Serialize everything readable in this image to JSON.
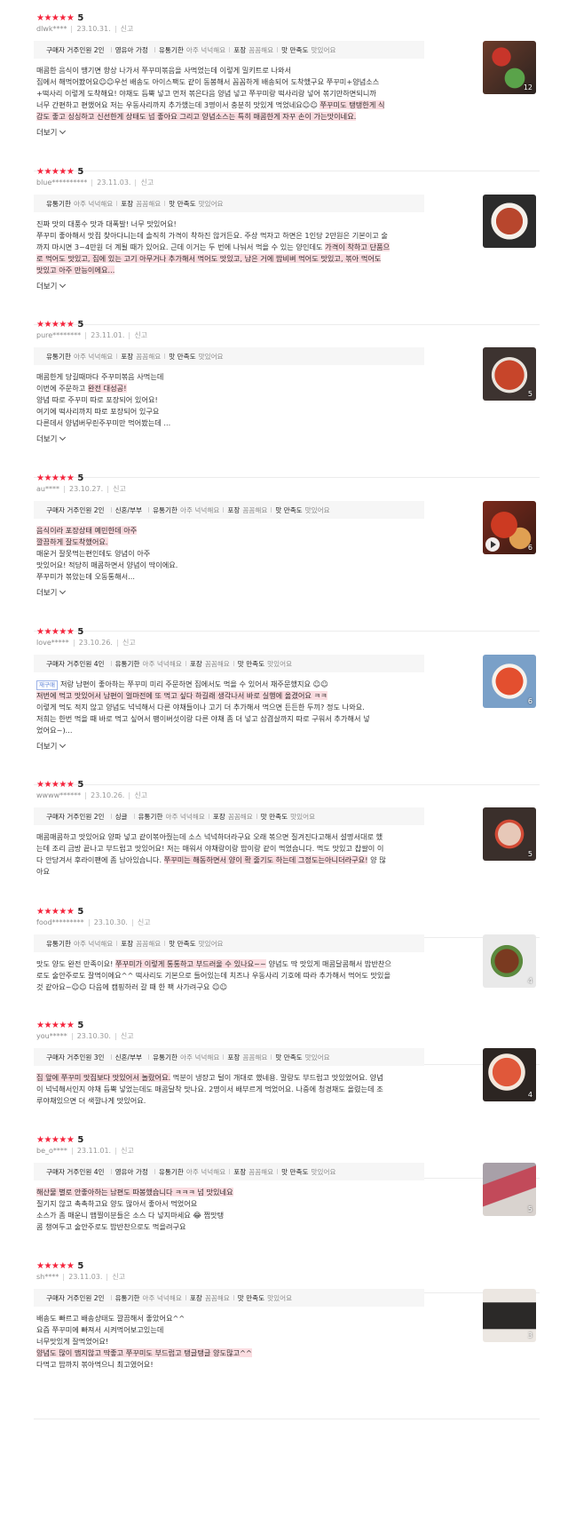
{
  "report_label": "신고",
  "more_label": "더보기",
  "rating_stars": "★★★★★",
  "reviews": [
    {
      "score": "5",
      "user": "dlwk****",
      "date": "23.10.31.",
      "options": [
        {
          "k": "구매자 거주인원 2인",
          "v": ""
        },
        {
          "k": "영유아 가정",
          "v": ""
        },
        {
          "k": "유통기한",
          "v": "아주 넉넉해요"
        },
        {
          "k": "포장",
          "v": "꼼꼼해요"
        },
        {
          "k": "맛 만족도",
          "v": "맛있어요"
        }
      ],
      "lines": [
        [
          {
            "t": "매콤한 음식이 땡기면 항상 나가서 쭈꾸미볶음을 사먹었는데 이렇게 밀키트로 나와서"
          }
        ],
        [
          {
            "t": "집에서 해먹어봤어요☺☺우선 배송도 아이스팩도 같이 동봉해서 꼼꼼하게 배송되어 도착했구요 쭈꾸미+양념소스"
          }
        ],
        [
          {
            "t": "+떡사리 이렇게 도착해요! 야채도 듬뿍 넣고 먼저 볶은다음 양념 넣고 쭈꾸미랑 떡사리랑 넣어 볶기만하면되니까"
          }
        ],
        [
          {
            "t": "너무 간편하고 편했어요 저는 우동사리까지 추가했는데 3명이서 충분히 맛있게 먹었네요☺☺ "
          },
          {
            "t": "쭈꾸미도 탱탱한게 식",
            "h": true
          }
        ],
        [
          {
            "t": "감도 좋고 싱싱하고 신선한게 상태도 넘 좋아요 그리고 양념소스는 특히 매콤한게 자꾸 손이 가는맛이네요.",
            "h": true
          }
        ]
      ],
      "photo_count": "12",
      "video": false
    },
    {
      "score": "5",
      "user": "blue**********",
      "date": "23.11.03.",
      "options": [
        {
          "k": "유통기한",
          "v": "아주 넉넉해요"
        },
        {
          "k": "포장",
          "v": "꼼꼼해요"
        },
        {
          "k": "맛 만족도",
          "v": "맛있어요"
        }
      ],
      "lines": [
        [
          {
            "t": "진짜 맛의 대풍수 맛과 대폭발! 너무 맛있어요!"
          }
        ],
        [
          {
            "t": "쭈꾸미 좋아해서 맛집 찾아다니는데 솔직히 가격이 착하진 않거든요. 주상 먹자고 하면은 1인당 2만원은 기본이고 술"
          }
        ],
        [
          {
            "t": "까지 마시면 3~4만원 더 계될 때가 있어요. 근데 이거는 두 번에 나눠서 먹을 수 있는 양인데도 "
          },
          {
            "t": "가격이 착하고 단품으",
            "h": true
          }
        ],
        [
          {
            "t": "로 먹어도 맛있고, 집에 있는 고기 아무거나 추가해서 먹어도 맛있고, 남은 거에 밥비벼 먹어도 맛있고, 볶아 먹어도",
            "h": true
          }
        ],
        [
          {
            "t": "맛있고 아주 만능이에요...",
            "h": true
          }
        ]
      ],
      "photo_count": "",
      "video": false
    },
    {
      "score": "5",
      "user": "pure********",
      "date": "23.11.01.",
      "options": [
        {
          "k": "유통기한",
          "v": "아주 넉넉해요"
        },
        {
          "k": "포장",
          "v": "꼼꼼해요"
        },
        {
          "k": "맛 만족도",
          "v": "맛있어요"
        }
      ],
      "lines": [
        [
          {
            "t": "매콤한게 당길때마다 주꾸미볶음 사먹는데"
          }
        ],
        [
          {
            "t": "이번에 주문하고 "
          },
          {
            "t": "완전 대성공!",
            "h": true
          }
        ],
        [
          {
            "t": "양념 따로 주꾸미 따로 포장되어 있어요!"
          }
        ],
        [
          {
            "t": "여기에 떡사리까지 따로 포장되어 있구요"
          }
        ],
        [
          {
            "t": "다른데서 양념버무린주꾸미만 먹어봤는데 ..."
          }
        ]
      ],
      "photo_count": "5",
      "video": false
    },
    {
      "score": "5",
      "user": "au****",
      "date": "23.10.27.",
      "options": [
        {
          "k": "구매자 거주인원 2인",
          "v": ""
        },
        {
          "k": "신혼/부부",
          "v": ""
        },
        {
          "k": "유통기한",
          "v": "아주 넉넉해요"
        },
        {
          "k": "포장",
          "v": "꼼꼼해요"
        },
        {
          "k": "맛 만족도",
          "v": "맛있어요"
        }
      ],
      "lines": [
        [
          {
            "t": "음식이라 포장상태 예민한데 아주",
            "h": true
          }
        ],
        [
          {
            "t": "깔끔하게 잘도착했어요.",
            "h": true
          }
        ],
        [
          {
            "t": "매운거 잘못먹는편인데도 양념이 아주"
          }
        ],
        [
          {
            "t": "맛있어요! 적당히 매콤하면서 양념이 딱이에요."
          }
        ],
        [
          {
            "t": "쭈꾸미가 볶았는데 오동통해서..."
          }
        ]
      ],
      "photo_count": "6",
      "video": true
    },
    {
      "score": "5",
      "user": "love*****",
      "date": "23.10.26.",
      "options": [
        {
          "k": "구매자 거주인원 4인",
          "v": ""
        },
        {
          "k": "유통기한",
          "v": "아주 넉넉해요"
        },
        {
          "k": "포장",
          "v": "꼼꼼해요"
        },
        {
          "k": "맛 만족도",
          "v": "맛있어요"
        }
      ],
      "badge": "재구매",
      "lines": [
        [
          {
            "t": "저랑 남편이 좋아하는 쭈꾸미 미리 주문하면 집에서도 먹을 수 있어서 재주문했지요 ☺☺"
          }
        ],
        [
          {
            "t": "저번에 먹고 맛있어서 남편이 얼마전에 또 먹고 싶다 하길래 생각나서 바로 실행에 옮겼어요 ㅋㅋ",
            "h": true
          }
        ],
        [
          {
            "t": "이렇게 먹도 적지 않고 양념도 넉넉해서 다른 야채들이나 고기 더 추가해서 먹으면 든든한 두끼? 정도 나와요."
          }
        ],
        [
          {
            "t": "저희는 한번 먹을 때 바로 먹고 싶어서 팽이버섯이랑 다른 야채 좀 더 넣고 삼겹살까지 따로 구워서 추가해서 넣"
          }
        ],
        [
          {
            "t": "었어요~)..."
          }
        ]
      ],
      "photo_count": "6",
      "video": false
    },
    {
      "score": "5",
      "user": "wwww******",
      "date": "23.10.26.",
      "options": [
        {
          "k": "구매자 거주인원 2인",
          "v": ""
        },
        {
          "k": "싱글",
          "v": ""
        },
        {
          "k": "유통기한",
          "v": "아주 넉넉해요"
        },
        {
          "k": "포장",
          "v": "꼼꼼해요"
        },
        {
          "k": "맛 만족도",
          "v": "맛있어요"
        }
      ],
      "lines": [
        [
          {
            "t": "매콤매콤하고 맛있어요 양파 넣고 같이볶아줬는데 소스 넉넉하더라구요 오래 볶으면 질겨진다고해서 설명서대로 했"
          }
        ],
        [
          {
            "t": "는데 조리 금방 끝나고 부드럽고 맛있어요! 저는 매워서 야채랑이랑 밥이랑 같이 먹었습니다. 먹도 맛있고 찹쌀이 이"
          }
        ],
        [
          {
            "t": "다 안당겨서 후라이팬에 좀 남아있습니다. "
          },
          {
            "t": "쭈꾸미는 해동하면서 양이 확 줄기도 하는데 그정도는아니더라구요!",
            "h": true
          },
          {
            "t": " 양 많"
          }
        ],
        [
          {
            "t": "아요"
          }
        ]
      ],
      "photo_count": "5",
      "video": false
    },
    {
      "score": "5",
      "user": "food*********",
      "date": "23.10.30.",
      "options": [
        {
          "k": "유통기한",
          "v": "아주 넉넉해요"
        },
        {
          "k": "포장",
          "v": "꼼꼼해요"
        },
        {
          "k": "맛 만족도",
          "v": "맛있어요"
        }
      ],
      "lines": [
        [
          {
            "t": "맛도 양도 완전 만족이요! "
          },
          {
            "t": "쭈꾸미가 이렇게 통통하고 부드러울 수 있나요~~",
            "h": true
          },
          {
            "t": " 양념도 딱 맛있게 매콤달콤해서 밥반찬으"
          }
        ],
        [
          {
            "t": "로도 술안주로도 잘먹이에요^^ 떡사리도 기본으로 들어있는데 치즈나 우동사리 기호에 따라 추가해서 먹어도 맛있을"
          }
        ],
        [
          {
            "t": "것 같아요~☺☺ 다음에 캠핑하러 갈 때 한 팩 사가려구요 ☺☺"
          }
        ]
      ],
      "photo_count": "4",
      "video": false
    },
    {
      "score": "5",
      "user": "you*****",
      "date": "23.10.30.",
      "options": [
        {
          "k": "구매자 거주인원 3인",
          "v": ""
        },
        {
          "k": "신혼/부부",
          "v": ""
        },
        {
          "k": "유통기한",
          "v": "아주 넉넉해요"
        },
        {
          "k": "포장",
          "v": "꼼꼼해요"
        },
        {
          "k": "맛 만족도",
          "v": "맛있어요"
        }
      ],
      "lines": [
        [
          {
            "t": "집 앞에 쭈꾸미 맛집보다 맛있어서 놀랐어요.",
            "h": true
          },
          {
            "t": " 먹분이 냉장고 털이 개대로 했네용. 말랑도 부드럽고 맛있었어요. 양념"
          }
        ],
        [
          {
            "t": "이 넉넉해서인지 야채 듬뿍 넣었는데도 매콤달착 맛나요. 2명이서 배부르게 먹었어요. 나중에 청경채도 올렸는데 조"
          }
        ],
        [
          {
            "t": "루야채있으면 더 색깔나게 맛있어요."
          }
        ]
      ],
      "photo_count": "4",
      "video": false
    },
    {
      "score": "5",
      "user": "be_o****",
      "date": "23.11.01.",
      "options": [
        {
          "k": "구매자 거주인원 4인",
          "v": ""
        },
        {
          "k": "영유아 가정",
          "v": ""
        },
        {
          "k": "유통기한",
          "v": "아주 넉넉해요"
        },
        {
          "k": "포장",
          "v": "꼼꼼해요"
        },
        {
          "k": "맛 만족도",
          "v": "맛있어요"
        }
      ],
      "lines": [
        [
          {
            "t": "해산물 별로 안좋아하는 남편도 따봉했습니다 ㅋㅋㅋ 넘 맛있네요",
            "h": true
          }
        ],
        [
          {
            "t": "질기지 않고 촉촉하고요 양도 많아서 좋아서 먹었어요"
          }
        ],
        [
          {
            "t": "소스가 좀 매운니 맵찔이분들은 소스 다 넣지마세요 😂 쩝맛탱"
          }
        ],
        [
          {
            "t": "콤 챙여두고 술안주로도 밥반찬으로도 먹을려구요"
          }
        ]
      ],
      "photo_count": "5",
      "video": false
    },
    {
      "score": "5",
      "user": "sh****",
      "date": "23.11.03.",
      "options": [
        {
          "k": "구매자 거주인원 2인",
          "v": ""
        },
        {
          "k": "유통기한",
          "v": "아주 넉넉해요"
        },
        {
          "k": "포장",
          "v": "꼼꼼해요"
        },
        {
          "k": "맛 만족도",
          "v": "맛있어요"
        }
      ],
      "lines": [
        [
          {
            "t": "배송도 빠르고 배송상태도 깔끔해서 좋았어요^^"
          }
        ],
        [
          {
            "t": "요즘 쭈꾸미에 빠져서 시켜먹어보고있는데"
          }
        ],
        [
          {
            "t": "너무맛있게 잘먹었어요!"
          }
        ],
        [
          {
            "t": "양념도 많이 맵지않고 딱좋고 쭈꾸미도 부드럽고 탱글탱글 양도많고^^",
            "h": true
          }
        ],
        [
          {
            "t": "다먹고 밥까지 볶아먹으니 최고였어요!"
          }
        ]
      ],
      "photo_count": "3",
      "video": false
    }
  ]
}
